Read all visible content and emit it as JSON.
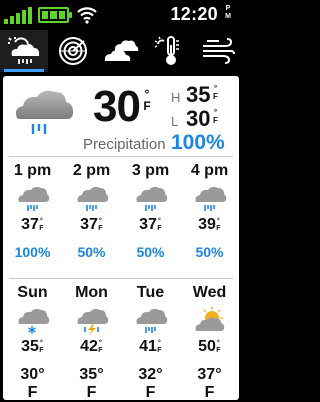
{
  "status_bar": {
    "time": "12:20",
    "ampm_top": "P",
    "ampm_bottom": "M",
    "signal_color": "#5fd52c",
    "battery_color": "#5fd52c"
  },
  "tabs": [
    {
      "icon": "partly-cloudy-rain-icon",
      "active": true
    },
    {
      "icon": "radar-icon",
      "active": false
    },
    {
      "icon": "clouds-icon",
      "active": false
    },
    {
      "icon": "thermometer-sun-icon",
      "active": false
    },
    {
      "icon": "wind-icon",
      "active": false
    }
  ],
  "current": {
    "icon": "cloud-rain-icon",
    "temp": "30",
    "unit_deg": "°",
    "unit_letter": "F",
    "high_label": "H",
    "high_value": "35",
    "low_label": "L",
    "low_value": "30",
    "precip_label": "Precipitation",
    "precip_value": "100%"
  },
  "hourly": [
    {
      "time": "1 pm",
      "icon": "cloud-rain-icon",
      "temp": "37",
      "precip": "100%"
    },
    {
      "time": "2 pm",
      "icon": "cloud-rain-icon",
      "temp": "37",
      "precip": "50%"
    },
    {
      "time": "3 pm",
      "icon": "cloud-rain-icon",
      "temp": "37",
      "precip": "50%"
    },
    {
      "time": "4 pm",
      "icon": "cloud-rain-icon",
      "temp": "39",
      "precip": "50%"
    }
  ],
  "daily": [
    {
      "day": "Sun",
      "icon": "cloud-snow-icon",
      "high": "35",
      "low": "30"
    },
    {
      "day": "Mon",
      "icon": "cloud-thunder-icon",
      "high": "42",
      "low": "35"
    },
    {
      "day": "Tue",
      "icon": "cloud-rain-icon",
      "high": "41",
      "low": "32"
    },
    {
      "day": "Wed",
      "icon": "partly-sunny-icon",
      "high": "50",
      "low": "37"
    }
  ],
  "colors": {
    "accent": "#1c86e0",
    "tab_indicator": "#3ca0ff"
  }
}
